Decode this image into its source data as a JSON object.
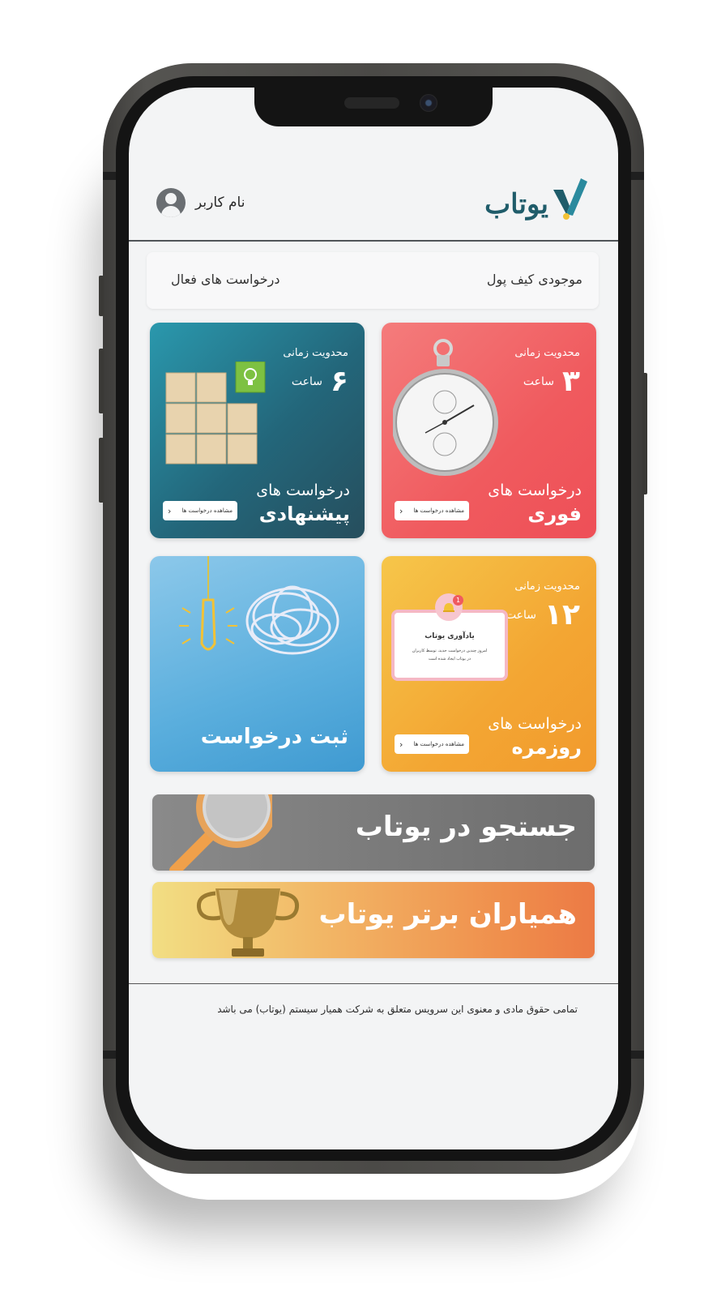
{
  "app": {
    "brand_name": "یوتاب",
    "brand_color": "#1f5c6a",
    "accent_color": "#f2c236",
    "user_label": "نام کاربر"
  },
  "summary_bar": {
    "wallet_label": "موجودی کیف پول",
    "active_requests_label": "درخواست های فعال"
  },
  "cards": {
    "urgent": {
      "limit_label": "محدویت زمانی",
      "hours": "۳",
      "hours_unit": "ساعت",
      "title_line1": "درخواست های",
      "title_line2": "فوری",
      "button_label": "مشاهده درخواست ها",
      "color": "#f05a5e",
      "icon": "stopwatch"
    },
    "suggested": {
      "limit_label": "محدویت زمانی",
      "hours": "۶",
      "hours_unit": "ساعت",
      "title_line1": "درخواست های",
      "title_line2": "پیشنهادی",
      "button_label": "مشاهده درخواست ها",
      "color": "#23667a",
      "icon": "wooden-blocks-lightbulb"
    },
    "daily": {
      "limit_label": "محدویت زمانی",
      "hours": "۱۲",
      "hours_unit": "ساعت",
      "title_line1": "درخواست های",
      "title_line2": "روزمره",
      "button_label": "مشاهده درخواست ها",
      "color": "#f3a633",
      "icon": "notification-bell",
      "notification": {
        "badge": "1",
        "title": "یادآوری یوتاب",
        "line1": "امروز چندین درخواست جدید، توسط کاربران",
        "line2": "در یوتاب ایجاد شده است"
      }
    },
    "register": {
      "title": "ثبت درخواست",
      "color": "#5aaedd",
      "icon": "paperclip-lightbulb"
    }
  },
  "banners": {
    "search": {
      "label": "جستجو در یوتاب",
      "icon": "magnifier"
    },
    "top_helpers": {
      "label": "همیاران برتر یوتاب",
      "icon": "trophy"
    }
  },
  "footer": {
    "copyright": "تمامی حقوق مادی و معنوی این سرویس متعلق به شرکت همیار سیستم (یوتاب) می باشد"
  }
}
